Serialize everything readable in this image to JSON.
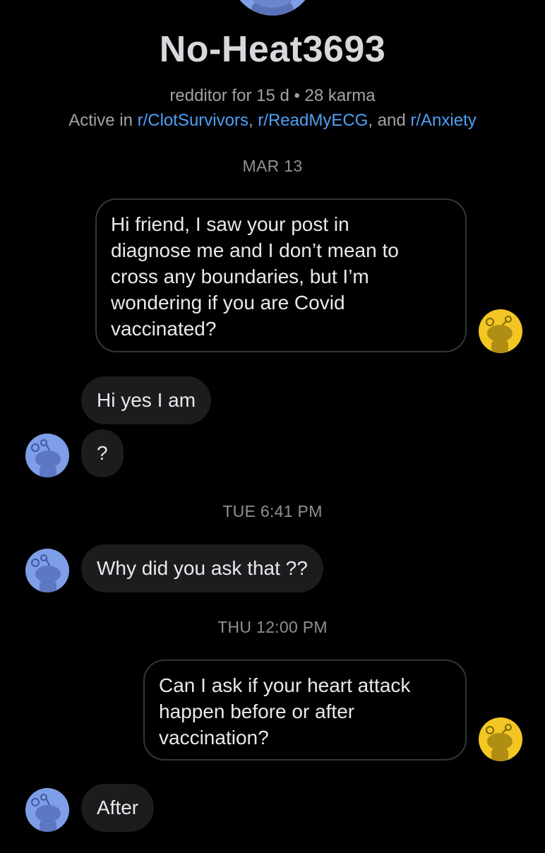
{
  "profile": {
    "username": "No-Heat3693",
    "meta": "redditor for 15 d • 28 karma",
    "active_prefix": "Active in ",
    "communities": [
      "r/ClotSurvivors",
      "r/ReadMyECG",
      "r/Anxiety"
    ],
    "sep1": ", ",
    "sep2": ", and "
  },
  "timestamps": {
    "t1": "MAR 13",
    "t2": "TUE 6:41 PM",
    "t3": "THU 12:00 PM"
  },
  "messages": [
    {
      "side": "sent",
      "lines": [
        "Hi friend, I saw your post in",
        "diagnose me  and I don’t mean to",
        "cross any boundaries, but I’m",
        "wondering if you are Covid",
        "vaccinated?"
      ]
    },
    {
      "side": "received",
      "text": "Hi yes I am"
    },
    {
      "side": "received",
      "text": "?"
    },
    {
      "side": "received",
      "text": "Why did you ask that ??"
    },
    {
      "side": "sent",
      "lines": [
        "Can I ask if your heart attack",
        "happen before or after",
        "vaccination?"
      ]
    },
    {
      "side": "received",
      "text": "After"
    }
  ],
  "avatars": {
    "sender_icon": "reddit-snoo-yellow-icon",
    "receiver_icon": "reddit-snoo-blue-icon",
    "sender_color": "#f3c623",
    "receiver_color": "#7e9ee8"
  },
  "colors": {
    "background": "#000000",
    "link": "#4f9ff5",
    "received_bubble": "#1c1c1e",
    "sent_border": "#343538"
  }
}
